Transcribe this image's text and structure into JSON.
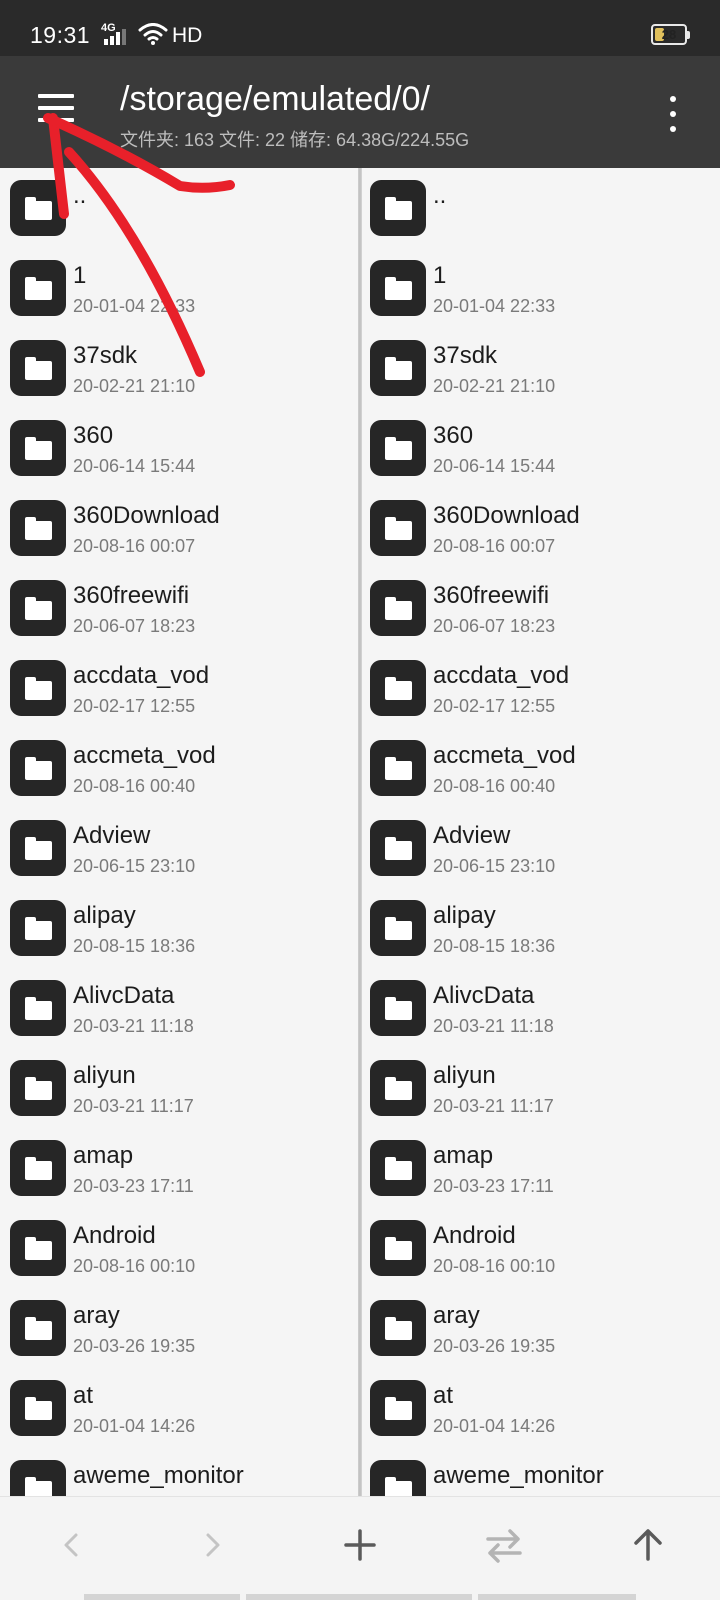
{
  "status_bar": {
    "time": "19:31",
    "network": "4G",
    "hd": "HD",
    "battery": "28"
  },
  "toolbar": {
    "path": "/storage/emulated/0/",
    "stats": "文件夹: 163  文件: 22  储存: 64.38G/224.55G",
    "menu_icon": "hamburger-menu-icon",
    "overflow_icon": "overflow-menu-icon"
  },
  "left_pane": [
    {
      "name": "..",
      "date": ""
    },
    {
      "name": "1",
      "date": "20-01-04 22:33"
    },
    {
      "name": "37sdk",
      "date": "20-02-21 21:10"
    },
    {
      "name": "360",
      "date": "20-06-14 15:44"
    },
    {
      "name": "360Download",
      "date": "20-08-16 00:07"
    },
    {
      "name": "360freewifi",
      "date": "20-06-07 18:23"
    },
    {
      "name": "accdata_vod",
      "date": "20-02-17 12:55"
    },
    {
      "name": "accmeta_vod",
      "date": "20-08-16 00:40"
    },
    {
      "name": "Adview",
      "date": "20-06-15 23:10"
    },
    {
      "name": "alipay",
      "date": "20-08-15 18:36"
    },
    {
      "name": "AlivcData",
      "date": "20-03-21 11:18"
    },
    {
      "name": "aliyun",
      "date": "20-03-21 11:17"
    },
    {
      "name": "amap",
      "date": "20-03-23 17:11"
    },
    {
      "name": "Android",
      "date": "20-08-16 00:10"
    },
    {
      "name": "aray",
      "date": "20-03-26 19:35"
    },
    {
      "name": "at",
      "date": "20-01-04 14:26"
    },
    {
      "name": "aweme_monitor",
      "date": ""
    }
  ],
  "right_pane": [
    {
      "name": "..",
      "date": ""
    },
    {
      "name": "1",
      "date": "20-01-04 22:33"
    },
    {
      "name": "37sdk",
      "date": "20-02-21 21:10"
    },
    {
      "name": "360",
      "date": "20-06-14 15:44"
    },
    {
      "name": "360Download",
      "date": "20-08-16 00:07"
    },
    {
      "name": "360freewifi",
      "date": "20-06-07 18:23"
    },
    {
      "name": "accdata_vod",
      "date": "20-02-17 12:55"
    },
    {
      "name": "accmeta_vod",
      "date": "20-08-16 00:40"
    },
    {
      "name": "Adview",
      "date": "20-06-15 23:10"
    },
    {
      "name": "alipay",
      "date": "20-08-15 18:36"
    },
    {
      "name": "AlivcData",
      "date": "20-03-21 11:18"
    },
    {
      "name": "aliyun",
      "date": "20-03-21 11:17"
    },
    {
      "name": "amap",
      "date": "20-03-23 17:11"
    },
    {
      "name": "Android",
      "date": "20-08-16 00:10"
    },
    {
      "name": "aray",
      "date": "20-03-26 19:35"
    },
    {
      "name": "at",
      "date": "20-01-04 14:26"
    },
    {
      "name": "aweme_monitor",
      "date": ""
    }
  ],
  "bottom_bar": {
    "icons": [
      "chevron-left-icon",
      "chevron-right-icon",
      "plus-icon",
      "swap-icon",
      "arrow-up-icon"
    ]
  },
  "colors": {
    "toolbar_bg": "#3a3a3a",
    "status_bg": "#2a2a2a",
    "folder_icon": "#262626",
    "annotation": "#e8202a"
  }
}
